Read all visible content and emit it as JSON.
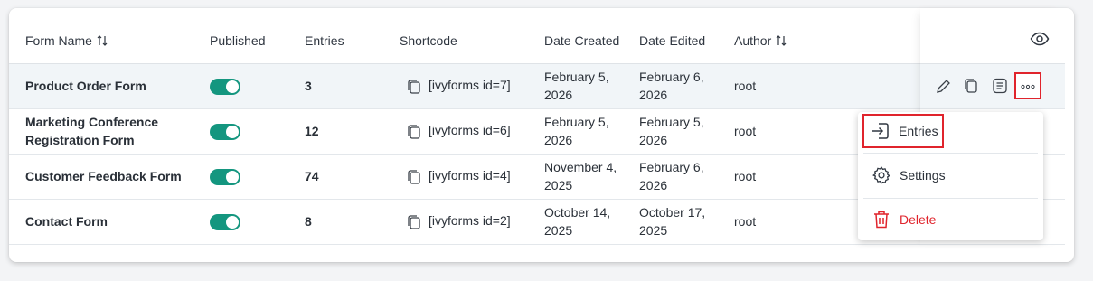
{
  "columns": {
    "form_name": "Form Name",
    "published": "Published",
    "entries": "Entries",
    "shortcode": "Shortcode",
    "date_created": "Date Created",
    "date_edited": "Date Edited",
    "author": "Author"
  },
  "rows": [
    {
      "name_line1": "Product Order Form",
      "name_line2": "",
      "entries": "3",
      "shortcode": "[ivyforms id=7]",
      "created_line1": "February 5,",
      "created_line2": "2026",
      "edited_line1": "February 6,",
      "edited_line2": "2026",
      "author": "root",
      "published": true
    },
    {
      "name_line1": "Marketing Conference",
      "name_line2": "Registration Form",
      "entries": "12",
      "shortcode": "[ivyforms id=6]",
      "created_line1": "February 5,",
      "created_line2": "2026",
      "edited_line1": "February 5,",
      "edited_line2": "2026",
      "author": "root",
      "published": true
    },
    {
      "name_line1": "Customer Feedback Form",
      "name_line2": "",
      "entries": "74",
      "shortcode": "[ivyforms id=4]",
      "created_line1": "November 4,",
      "created_line2": "2025",
      "edited_line1": "February 6,",
      "edited_line2": "2026",
      "author": "root",
      "published": true
    },
    {
      "name_line1": "Contact Form",
      "name_line2": "",
      "entries": "8",
      "shortcode": "[ivyforms id=2]",
      "created_line1": "October 14,",
      "created_line2": "2025",
      "edited_line1": "October 17,",
      "edited_line2": "2025",
      "author": "root",
      "published": true
    }
  ],
  "menu": {
    "entries": "Entries",
    "settings": "Settings",
    "delete": "Delete"
  },
  "colors": {
    "toggle_on": "#14967f",
    "highlight_border": "#e0242c",
    "delete": "#e0242c"
  },
  "icons": [
    "sort-icon",
    "eye-icon",
    "copy-icon",
    "edit-icon",
    "duplicate-icon",
    "form-icon",
    "more-icon",
    "entries-icon",
    "settings-icon",
    "trash-icon"
  ]
}
